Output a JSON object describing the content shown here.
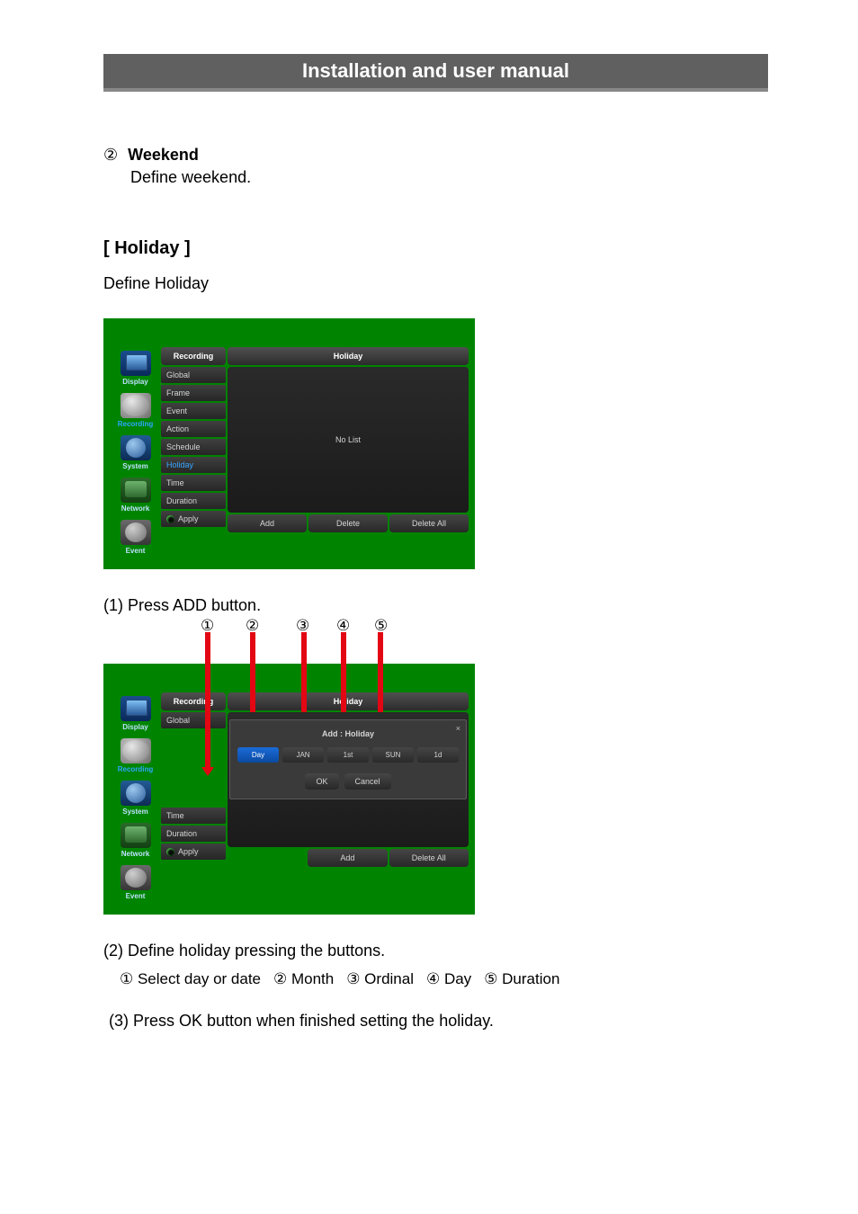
{
  "page_title": "Installation and user manual",
  "section_weekend": {
    "num": "②",
    "title": "Weekend",
    "desc": "Define weekend."
  },
  "section_holiday": {
    "title": "[ Holiday ]",
    "desc": "Define Holiday"
  },
  "fig1": {
    "sidebar": [
      {
        "label": "Display",
        "cls": "icon-display",
        "sel": false
      },
      {
        "label": "Recording",
        "cls": "icon-rec",
        "sel": true
      },
      {
        "label": "System",
        "cls": "icon-sys",
        "sel": false
      },
      {
        "label": "Network",
        "cls": "icon-net",
        "sel": false
      },
      {
        "label": "Event",
        "cls": "icon-evt",
        "sel": false
      }
    ],
    "menu": {
      "header": "Recording",
      "items": [
        {
          "label": "Global",
          "sel": false
        },
        {
          "label": "Frame",
          "sel": false
        },
        {
          "label": "Event",
          "sel": false
        },
        {
          "label": "Action",
          "sel": false
        },
        {
          "label": "Schedule",
          "sel": false
        },
        {
          "label": "Holiday",
          "sel": true
        },
        {
          "label": "Time",
          "sel": false
        },
        {
          "label": "Duration",
          "sel": false
        }
      ],
      "apply": "Apply"
    },
    "main": {
      "title": "Holiday",
      "empty": "No List",
      "buttons": {
        "add": "Add",
        "del": "Delete",
        "delall": "Delete All"
      }
    }
  },
  "step1": "(1) Press ADD button.",
  "callouts": [
    "①",
    "②",
    "③",
    "④",
    "⑤"
  ],
  "fig2": {
    "modal": {
      "title": "Add : Holiday",
      "chips": [
        {
          "label": "Day",
          "sel": true
        },
        {
          "label": "JAN",
          "sel": false
        },
        {
          "label": "1st",
          "sel": false
        },
        {
          "label": "SUN",
          "sel": false
        },
        {
          "label": "1d",
          "sel": false
        }
      ],
      "ok": "OK",
      "cancel": "Cancel",
      "close": "×"
    },
    "menu_visible_top": {
      "header": "Recording",
      "item": "Global"
    },
    "menu_visible_bot": [
      "Time",
      "Duration"
    ],
    "bottom_buttons": {
      "add": "Add",
      "delall": "Delete All"
    }
  },
  "step2": {
    "line": "(2) Define holiday pressing the buttons.",
    "legend": [
      {
        "n": "①",
        "t": "Select day or date"
      },
      {
        "n": "②",
        "t": "Month"
      },
      {
        "n": "③",
        "t": "Ordinal"
      },
      {
        "n": "④",
        "t": "Day"
      },
      {
        "n": "⑤",
        "t": "Duration"
      }
    ]
  },
  "step3": "(3) Press OK button when finished setting the holiday."
}
